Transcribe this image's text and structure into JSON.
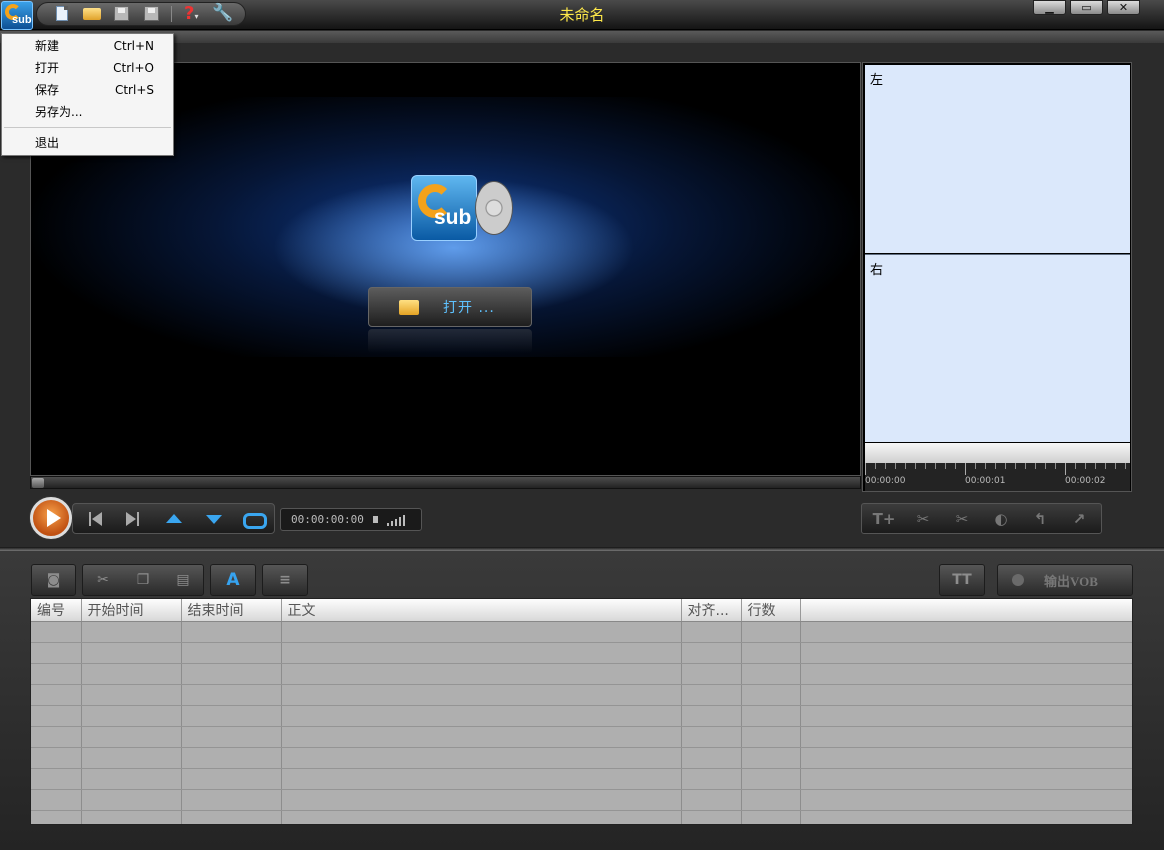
{
  "window": {
    "title": "未命名",
    "controls": {
      "minimize": "▁",
      "maximize": "▭",
      "close": "✕"
    }
  },
  "quickbar": {
    "icons": [
      "new-file-icon",
      "open-folder-icon",
      "save-icon",
      "save-as-icon",
      "help-icon",
      "settings-wrench-icon"
    ]
  },
  "file_menu": {
    "items": [
      {
        "label": "新建",
        "shortcut": "Ctrl+N"
      },
      {
        "label": "打开",
        "shortcut": "Ctrl+O"
      },
      {
        "label": "保存",
        "shortcut": "Ctrl+S"
      },
      {
        "label": "另存为...",
        "shortcut": ""
      },
      {
        "label": "退出",
        "shortcut": ""
      }
    ]
  },
  "video": {
    "logo_text": "sub",
    "open_label": "打开 ..."
  },
  "preview": {
    "left_label": "左",
    "right_label": "右",
    "ruler": [
      "00:00:00",
      "00:00:01",
      "00:00:02"
    ]
  },
  "transport": {
    "time": "00:00:00:00",
    "icons": [
      "play-icon",
      "previous-icon",
      "next-icon",
      "up-icon",
      "down-icon",
      "loop-icon",
      "volume-icon"
    ]
  },
  "edit_tools": {
    "icons": [
      "insert-text-icon",
      "cut-left-icon",
      "cut-right-icon",
      "key-text-icon",
      "undo-arrow-icon",
      "redo-arrow-icon"
    ]
  },
  "lower_toolbar": {
    "icons": [
      "find-binoculars-icon",
      "cut-icon",
      "copy-icon",
      "paste-icon",
      "font-icon",
      "align-icon",
      "subtitle-style-icon"
    ],
    "export_label": "输出VOB"
  },
  "subtitle_table": {
    "columns": [
      "编号",
      "开始时间",
      "结束时间",
      "正文",
      "对齐...",
      "行数",
      ""
    ],
    "empty_rows": 10
  },
  "colors": {
    "title_text": "#ffe94a",
    "accent_blue": "#36a3f0",
    "preview_bg": "#dbe8fb",
    "play_orange": "#e8782a"
  }
}
